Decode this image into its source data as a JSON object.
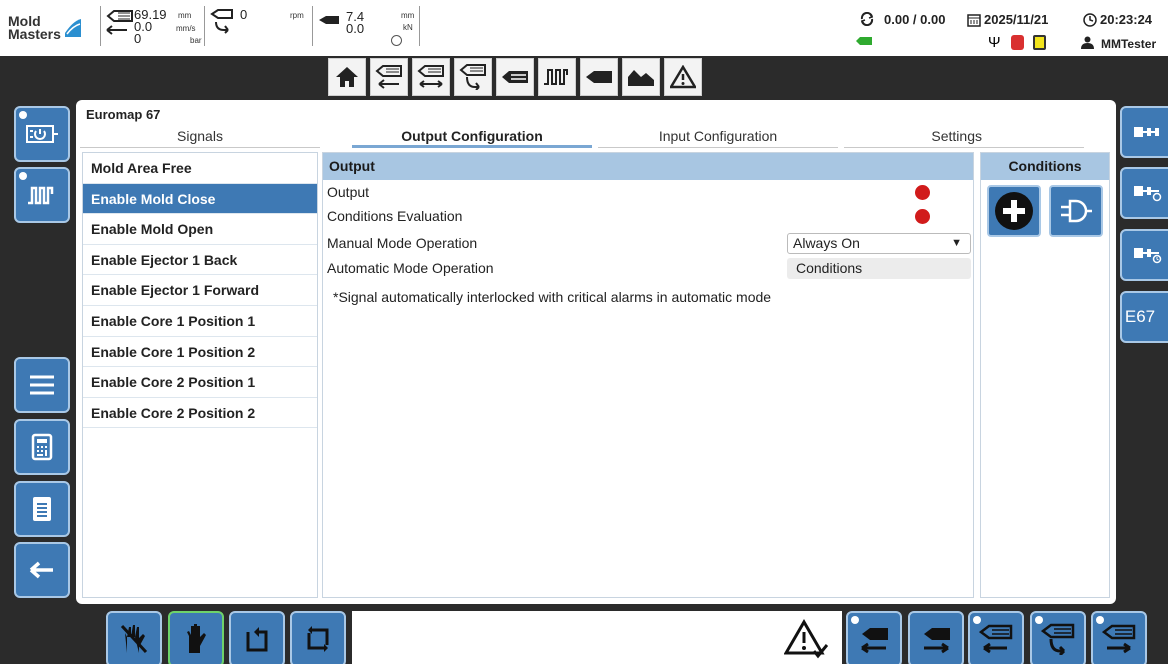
{
  "header": {
    "logo_line1": "Mold",
    "logo_line2": "Masters",
    "position_value": "69.19",
    "position_unit": "mm",
    "speed_value": "0.0",
    "speed_unit": "mm/s",
    "pressure_value": "0",
    "pressure_unit": "bar",
    "screw_value": "0",
    "screw_unit": "rpm",
    "clamp_position_value": "7.4",
    "clamp_position_unit": "mm",
    "clamp_force_value": "0.0",
    "clamp_force_unit": "kN",
    "cycle_counter": "0.00 / 0.00",
    "date": "2025/11/21",
    "time": "20:23:24",
    "user": "MMTester"
  },
  "panel": {
    "title": "Euromap 67",
    "tabs": [
      {
        "label": "Signals"
      },
      {
        "label": "Output Configuration"
      },
      {
        "label": "Input Configuration"
      },
      {
        "label": "Settings"
      }
    ],
    "signals": [
      "Mold Area Free",
      "Enable Mold Close",
      "Enable Mold Open",
      "Enable Ejector 1 Back",
      "Enable Ejector 1 Forward",
      "Enable Core 1 Position 1",
      "Enable Core 1 Position 2",
      "Enable Core 2 Position 1",
      "Enable Core 2 Position 2"
    ],
    "selected_signal": "Enable Mold Close",
    "output": {
      "header": "Output",
      "row_output": "Output",
      "row_conditions_eval": "Conditions Evaluation",
      "row_manual": "Manual Mode Operation",
      "row_auto": "Automatic Mode Operation",
      "manual_value": "Always On",
      "auto_value": "Conditions",
      "note": "*Signal automatically interlocked with critical alarms in automatic mode",
      "led_color": "#d11b1b"
    },
    "conditions": {
      "header": "Conditions"
    }
  },
  "right_rail": {
    "e67_label": "E67"
  },
  "colors": {
    "accent": "#3e79b4",
    "header_blue": "#a8c6e2"
  }
}
